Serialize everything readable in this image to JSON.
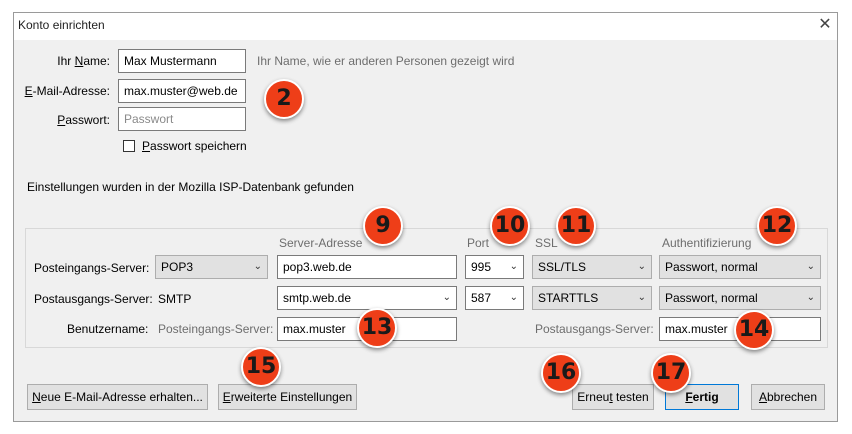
{
  "window": {
    "title": "Konto einrichten",
    "close": "✕"
  },
  "account": {
    "name_label": "Ihr Name:",
    "name_value": "Max Mustermann",
    "name_hint": "Ihr Name, wie er anderen Personen gezeigt wird",
    "email_label": "E-Mail-Adresse:",
    "email_value": "max.muster@web.de",
    "password_label": "Passwort:",
    "password_placeholder": "Passwort",
    "save_password_label": "Passwort speichern",
    "save_password_checked": false
  },
  "info_text": "Einstellungen wurden in der Mozilla ISP-Datenbank gefunden",
  "columns": {
    "server": "Server-Adresse",
    "port": "Port",
    "ssl": "SSL",
    "auth": "Authentifizierung"
  },
  "incoming": {
    "label": "Posteingangs-Server:",
    "protocol": "POP3",
    "server": "pop3.web.de",
    "port": "995",
    "ssl": "SSL/TLS",
    "auth": "Passwort, normal"
  },
  "outgoing": {
    "label": "Postausgangs-Server:",
    "protocol": "SMTP",
    "server": "smtp.web.de",
    "port": "587",
    "ssl": "STARTTLS",
    "auth": "Passwort, normal"
  },
  "username": {
    "label": "Benutzername:",
    "incoming_label": "Posteingangs-Server:",
    "incoming_value": "max.muster",
    "outgoing_label": "Postausgangs-Server:",
    "outgoing_value": "max.muster"
  },
  "buttons": {
    "new_address": "Neue E-Mail-Adresse erhalten...",
    "advanced": "Erweiterte Einstellungen",
    "retest": "Erneut testen",
    "done": "Fertig",
    "cancel": "Abbrechen"
  },
  "badges": [
    "2",
    "9",
    "10",
    "11",
    "12",
    "13",
    "14",
    "15",
    "16",
    "17"
  ],
  "colors": {
    "badge": "#ee3e18",
    "default_button_border": "#0078d7"
  }
}
